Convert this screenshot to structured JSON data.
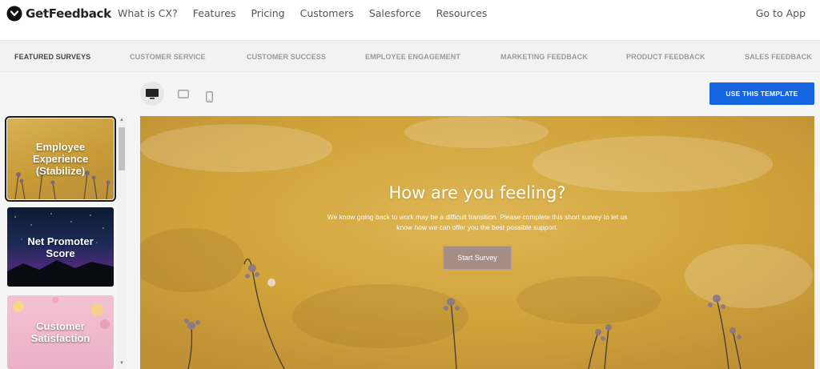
{
  "brand": {
    "name": "GetFeedback"
  },
  "nav": {
    "links": [
      "What is CX?",
      "Features",
      "Pricing",
      "Customers",
      "Salesforce",
      "Resources"
    ],
    "go_to_app": "Go to App"
  },
  "categories": [
    {
      "label": "FEATURED SURVEYS",
      "active": true
    },
    {
      "label": "CUSTOMER SERVICE",
      "active": false
    },
    {
      "label": "CUSTOMER SUCCESS",
      "active": false
    },
    {
      "label": "EMPLOYEE ENGAGEMENT",
      "active": false
    },
    {
      "label": "MARKETING FEEDBACK",
      "active": false
    },
    {
      "label": "PRODUCT FEEDBACK",
      "active": false
    },
    {
      "label": "SALES FEEDBACK",
      "active": false
    }
  ],
  "devices": {
    "options": [
      "desktop-icon",
      "tablet-icon",
      "mobile-icon"
    ],
    "selected": "desktop-icon"
  },
  "use_template_label": "USE THIS TEMPLATE",
  "templates": [
    {
      "label": "Employee Experience (Stabilize)",
      "selected": true
    },
    {
      "label": "Net Promoter Score",
      "selected": false
    },
    {
      "label": "Customer Satisfaction",
      "selected": false
    }
  ],
  "survey": {
    "title": "How are you feeling?",
    "description": "We know going back to work may be a difficult transition. Please complete this short survey to let us know how we can offer you the best possible support.",
    "start_label": "Start Survey"
  },
  "colors": {
    "primary_button": "#1565e0",
    "preview_background": "#d6a83c",
    "start_button": "#a58d86"
  }
}
